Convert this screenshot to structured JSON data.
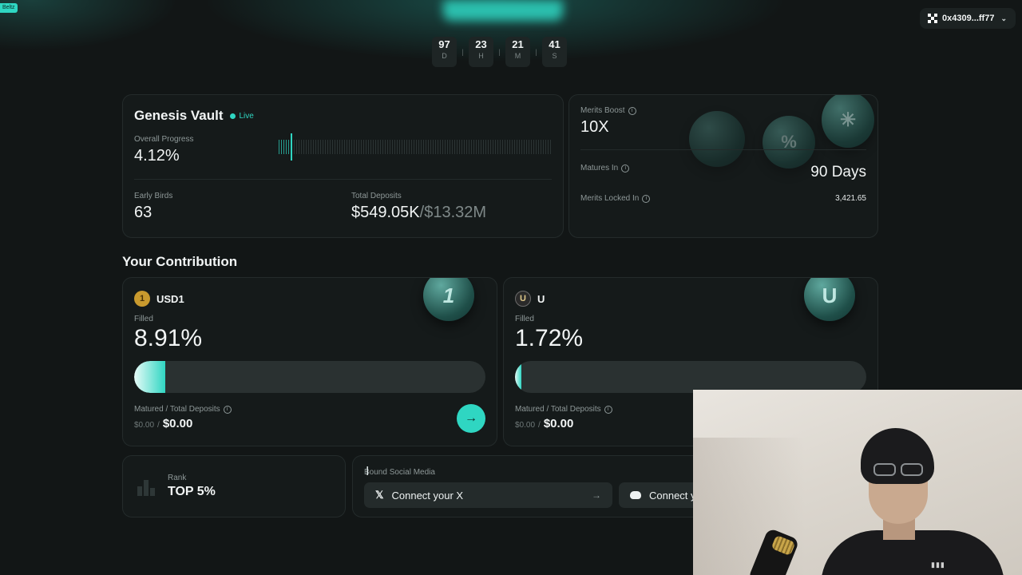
{
  "corner_tag": "Beltz",
  "wallet": {
    "address": "0x4309...ff77"
  },
  "countdown": [
    {
      "value": "97",
      "unit": "D"
    },
    {
      "value": "23",
      "unit": "H"
    },
    {
      "value": "21",
      "unit": "M"
    },
    {
      "value": "41",
      "unit": "S"
    }
  ],
  "vault": {
    "title": "Genesis Vault",
    "status": "Live",
    "progress_label": "Overall Progress",
    "progress_value": "4.12%",
    "progress_fraction": 0.0412,
    "early_birds_label": "Early Birds",
    "early_birds_value": "63",
    "total_deposits_label": "Total Deposits",
    "total_deposits_current": "$549.05K",
    "total_deposits_cap": "/$13.32M"
  },
  "merits": {
    "boost_label": "Merits Boost",
    "boost_value": "10X",
    "matures_label": "Matures In",
    "matures_value": "90 Days",
    "locked_label": "Merits Locked In",
    "locked_value": "3,421.65"
  },
  "contribution": {
    "title": "Your Contribution",
    "cards": [
      {
        "token": "USD1",
        "icon_text": "1",
        "filled_label": "Filled",
        "filled_value": "8.91%",
        "filled_fraction": 0.0891,
        "matured_label": "Matured / Total Deposits",
        "matured_value": "$0.00",
        "total_value": "$0.00"
      },
      {
        "token": "U",
        "icon_text": "U",
        "filled_label": "Filled",
        "filled_value": "1.72%",
        "filled_fraction": 0.0172,
        "matured_label": "Matured / Total Deposits",
        "matured_value": "$0.00",
        "total_value": "$0.00"
      }
    ]
  },
  "rank": {
    "label": "Rank",
    "value": "TOP 5%"
  },
  "social": {
    "label": "Bound Social Media",
    "x_button": "Connect your X",
    "discord_button": "Connect y"
  },
  "colors": {
    "accent": "#2fd6c2",
    "background": "#121616",
    "card": "#151a1a"
  },
  "icons": [
    "okx-logo-icon",
    "chevron-down-icon",
    "info-icon",
    "arrow-right-icon",
    "x-logo-icon",
    "discord-icon",
    "rank-bars-icon",
    "text-cursor-icon"
  ]
}
